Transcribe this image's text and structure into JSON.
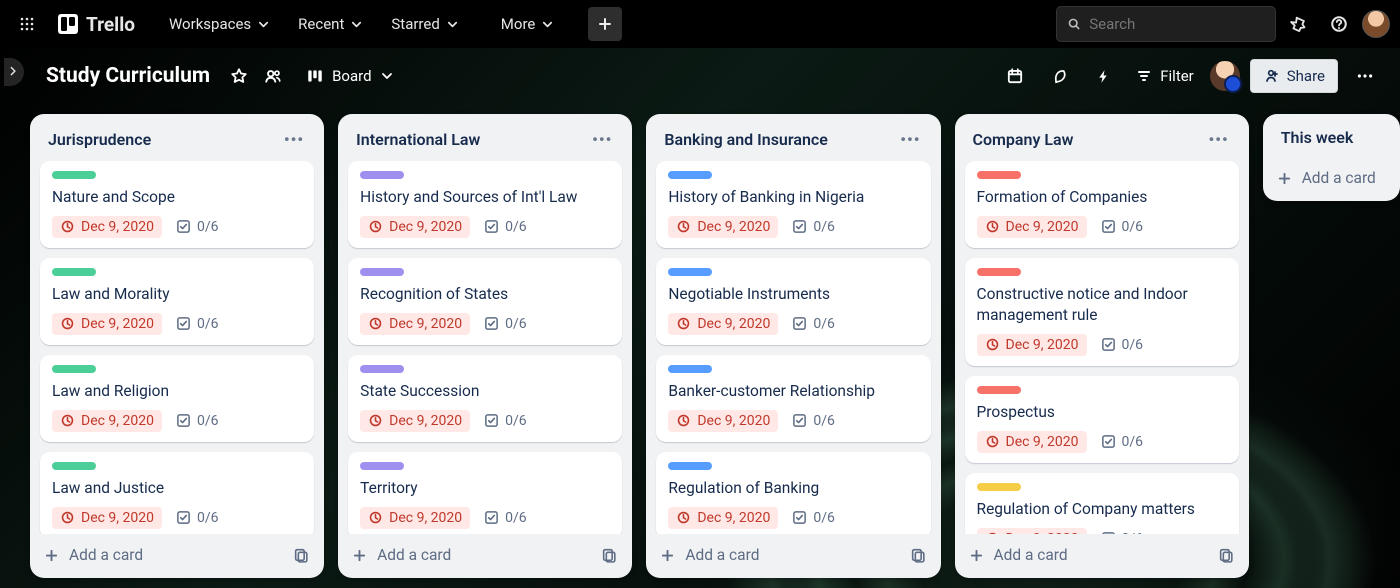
{
  "topbar": {
    "logo_text": "Trello",
    "menus": [
      "Workspaces",
      "Recent",
      "Starred",
      "More"
    ],
    "search_placeholder": "Search"
  },
  "boardbar": {
    "title": "Study Curriculum",
    "view_label": "Board",
    "filter_label": "Filter",
    "share_label": "Share"
  },
  "common": {
    "due_text": "Dec 9, 2020",
    "checklist_text": "0/6",
    "add_card_label": "Add a card"
  },
  "lists": [
    {
      "title": "Jurisprudence",
      "color_class": "green",
      "cards": [
        {
          "title": "Nature and Scope"
        },
        {
          "title": "Law and Morality"
        },
        {
          "title": "Law and Religion"
        },
        {
          "title": "Law and Justice"
        }
      ]
    },
    {
      "title": "International Law",
      "color_class": "purple",
      "cards": [
        {
          "title": "History and Sources of Int'l Law"
        },
        {
          "title": "Recognition of States"
        },
        {
          "title": "State Succession"
        },
        {
          "title": "Territory"
        }
      ]
    },
    {
      "title": "Banking and Insurance",
      "color_class": "blue",
      "cards": [
        {
          "title": "History of Banking in Nigeria"
        },
        {
          "title": "Negotiable Instruments"
        },
        {
          "title": "Banker-customer Relationship"
        },
        {
          "title": "Regulation of Banking"
        }
      ]
    },
    {
      "title": "Company Law",
      "color_class": "red",
      "cards": [
        {
          "title": "Formation of Companies"
        },
        {
          "title": "Constructive notice and Indoor management rule"
        },
        {
          "title": "Prospectus"
        },
        {
          "title": "Regulation of Company matters",
          "color_class": "yellow"
        }
      ]
    },
    {
      "title": "This week",
      "narrow": true,
      "cards": []
    }
  ]
}
